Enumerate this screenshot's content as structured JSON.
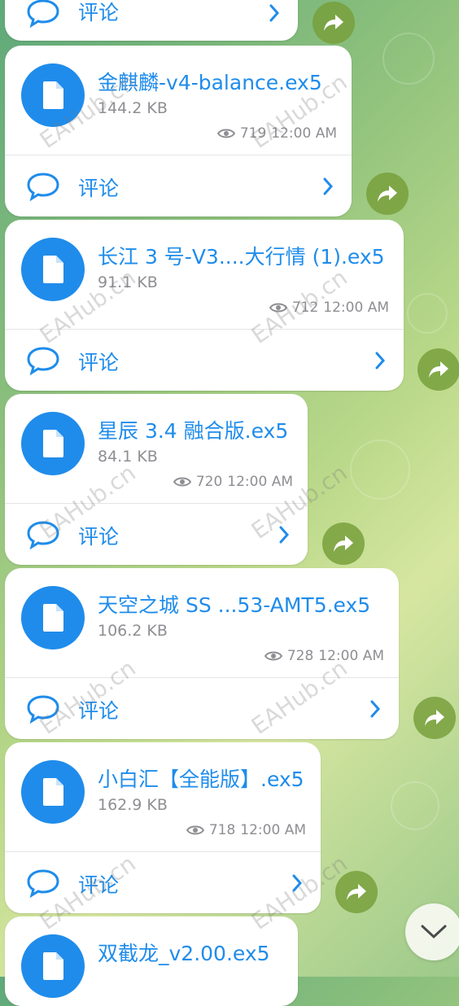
{
  "comment_label": "评论",
  "top_partial": {
    "comment_label": "评论"
  },
  "messages": [
    {
      "file_name": "金麒麟-v4-balance.ex5",
      "file_size": "144.2 KB",
      "views": "719",
      "time": "12:00 AM",
      "comment_label": "评论"
    },
    {
      "file_name": "长江 3 号-V3....大行情 (1).ex5",
      "file_size": "91.1 KB",
      "views": "712",
      "time": "12:00 AM",
      "comment_label": "评论"
    },
    {
      "file_name": "星辰 3.4 融合版.ex5",
      "file_size": "84.1 KB",
      "views": "720",
      "time": "12:00 AM",
      "comment_label": "评论"
    },
    {
      "file_name": "天空之城 SS ...53-AMT5.ex5",
      "file_size": "106.2 KB",
      "views": "728",
      "time": "12:00 AM",
      "comment_label": "评论"
    },
    {
      "file_name": "小白汇【全能版】.ex5",
      "file_size": "162.9 KB",
      "views": "718",
      "time": "12:00 AM",
      "comment_label": "评论"
    },
    {
      "file_name": "双截龙_v2.00.ex5"
    }
  ],
  "watermark": "EAHub.cn",
  "colors": {
    "accent": "#1f8ceb",
    "muted": "#8e8e93",
    "share_bg": "#7aa03c"
  },
  "icons": {
    "file": "file-icon",
    "comment": "comment-bubble-icon",
    "chevron": "chevron-right-icon",
    "share": "share-arrow-icon",
    "eye": "eye-icon",
    "scroll": "chevron-down-icon"
  }
}
